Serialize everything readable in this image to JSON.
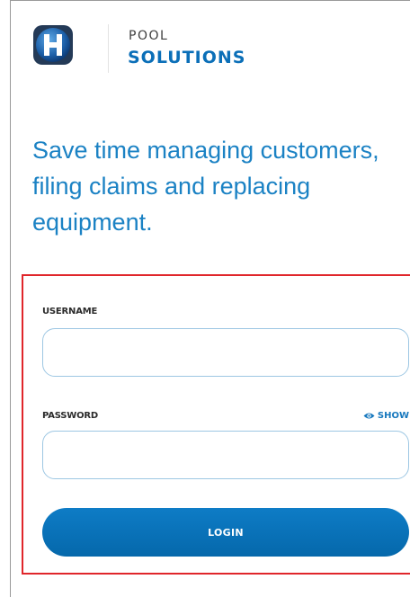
{
  "brand": {
    "line1": "POOL",
    "line2": "SOLUTIONS",
    "logo_icon": "h-logo-icon",
    "logo_letter": "H"
  },
  "headline": "Save time managing customers, filing claims and replacing equipment.",
  "login_form": {
    "username": {
      "label": "USERNAME",
      "value": "",
      "placeholder": ""
    },
    "password": {
      "label": "PASSWORD",
      "value": "",
      "placeholder": ""
    },
    "show_label": "SHOW",
    "show_icon": "eye-icon",
    "submit_label": "LOGIN"
  },
  "colors": {
    "brand_blue": "#0b6fb8",
    "headline_blue": "#1b82c4",
    "button_blue": "#0a72bb",
    "highlight_red": "#e0262b",
    "input_border": "#9dc7e3"
  }
}
